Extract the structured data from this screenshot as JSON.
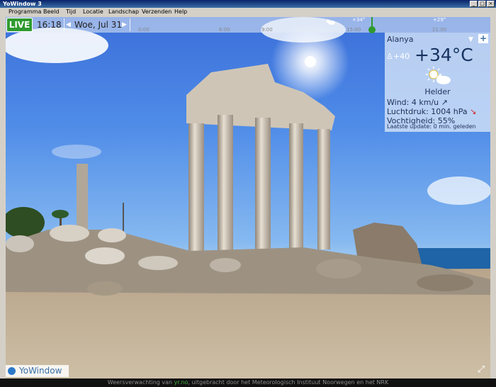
{
  "window": {
    "title": "YoWindow 3"
  },
  "menu": [
    "Programma",
    "Beeld",
    "Tijd",
    "Locatie",
    "Landschap",
    "Verzenden",
    "Help"
  ],
  "timebar": {
    "live_label": "LIVE",
    "time": "16:18",
    "date": "Woe, Jul 31",
    "ticks": [
      "0:00",
      "6:00",
      "9:00",
      "15:00",
      "21:00"
    ],
    "markers": [
      "+34°",
      "+29°"
    ]
  },
  "weather": {
    "city": "Alanya",
    "feels_like": "+40",
    "temperature": "+34°C",
    "condition": "Helder",
    "wind_label": "Wind:",
    "wind_value": "4 km/u",
    "pressure_label": "Luchtdruk:",
    "pressure_value": "1004 hPa",
    "humidity_label": "Vochtigheid:",
    "humidity_value": "55%",
    "update_label": "Laatste update:",
    "update_value": "0 min. geleden"
  },
  "logo": {
    "text": "YoWindow"
  },
  "status": {
    "prefix": "Weersverwachting van ",
    "link": "yr.no",
    "suffix": ", uitgebracht door het Meteorologisch Instituut Noorwegen en het NRK"
  },
  "colors": {
    "live": "#2f9a2f",
    "sky": "#4f8ce8",
    "panel": "#d2e2f6"
  }
}
